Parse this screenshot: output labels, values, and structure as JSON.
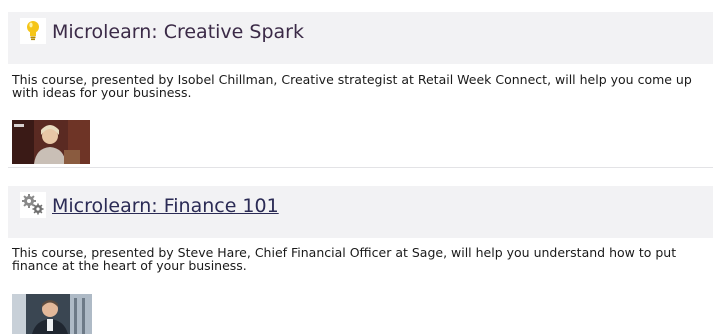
{
  "courses": [
    {
      "title": "Microlearn: Creative Spark",
      "icon": "lightbulb-icon",
      "description": "This course, presented by Isobel Chillman, Creative strategist at Retail Week Connect, will help you come up with ideas for your business.",
      "thumbnail": "course-video-thumbnail",
      "colors": {
        "title": "#3b2a47",
        "icon": "#f5c518",
        "header_bg": "#f2f2f4"
      }
    },
    {
      "title": "Microlearn: Finance 101",
      "icon": "gears-icon",
      "description": "This course, presented by Steve Hare, Chief Financial Officer at Sage, will help you understand how to put finance at the heart of your business.",
      "thumbnail": "course-video-thumbnail",
      "colors": {
        "title": "#2b2b55",
        "icon": "#8a8a8a",
        "header_bg": "#f2f2f4"
      }
    }
  ]
}
